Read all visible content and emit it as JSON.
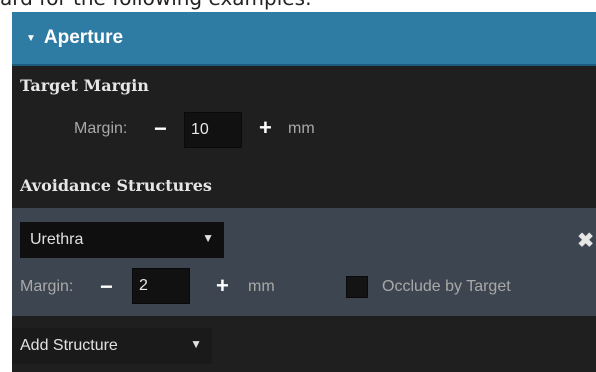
{
  "caption": "ard for the following examples:",
  "panel": {
    "title": "Aperture",
    "target_margin": {
      "heading": "Target Margin",
      "margin_label": "Margin:",
      "value": "10",
      "unit": "mm"
    },
    "avoidance": {
      "heading": "Avoidance Structures",
      "structure": {
        "selected": "Urethra",
        "margin_label": "Margin:",
        "value": "2",
        "unit": "mm",
        "occlude_label": "Occlude by Target",
        "occlude_checked": false
      },
      "add_structure_label": "Add Structure"
    }
  },
  "colors": {
    "header": "#2e7ba3",
    "panel_bg": "#1f1f1f",
    "card_bg": "#3d4650"
  },
  "icons": {
    "caret": "caret-down-icon",
    "close": "close-icon",
    "dropdown": "chevron-down-icon"
  }
}
